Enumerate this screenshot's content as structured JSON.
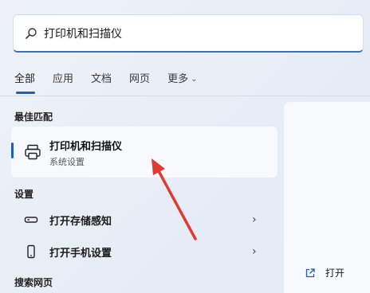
{
  "search": {
    "value": "打印机和扫描仪",
    "icon": "search-icon"
  },
  "tabs": [
    {
      "label": "全部",
      "active": true
    },
    {
      "label": "应用"
    },
    {
      "label": "文档"
    },
    {
      "label": "网页"
    },
    {
      "label": "更多"
    }
  ],
  "sections": {
    "best_match": "最佳匹配",
    "settings": "设置",
    "web": "搜索网页"
  },
  "best_match": {
    "title": "打印机和扫描仪",
    "subtitle": "系统设置",
    "icon": "printer-icon"
  },
  "settings_items": [
    {
      "label": "打开存储感知",
      "icon": "storage-icon"
    },
    {
      "label": "打开手机设置",
      "icon": "phone-icon"
    }
  ],
  "right_panel": {
    "open_label": "打开",
    "open_icon": "open-external-icon"
  },
  "colors": {
    "accent": "#1f5fb5",
    "annotation_arrow": "#e03a32"
  }
}
